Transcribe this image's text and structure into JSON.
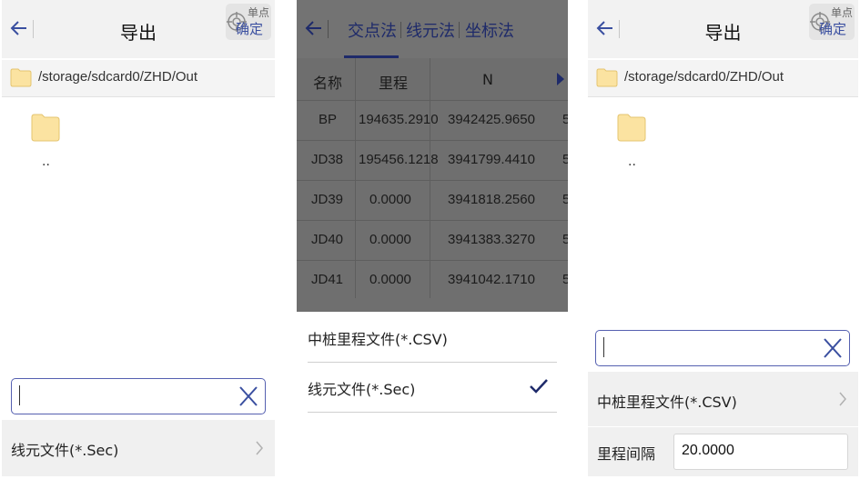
{
  "panel1": {
    "title": "导出",
    "confirm_label": "确定",
    "confirm_badge": "单点",
    "path": "/storage/sdcard0/ZHD/Out",
    "parent_dir": "..",
    "input_value": "",
    "format_row": "线元文件(*.Sec)"
  },
  "panel2": {
    "tabs": [
      "交点法",
      "线元法",
      "坐标法"
    ],
    "active_tab": "交点法",
    "columns": [
      "名称",
      "里程",
      "N"
    ],
    "rows": [
      {
        "name": "BP",
        "mileage": "194635.2910",
        "n": "3942425.9650",
        "e": "5"
      },
      {
        "name": "JD38",
        "mileage": "195456.1218",
        "n": "3941799.4410",
        "e": "5"
      },
      {
        "name": "JD39",
        "mileage": "0.0000",
        "n": "3941818.2560",
        "e": "5"
      },
      {
        "name": "JD40",
        "mileage": "0.0000",
        "n": "3941383.3270",
        "e": "5"
      },
      {
        "name": "JD41",
        "mileage": "0.0000",
        "n": "3941042.1710",
        "e": "5"
      }
    ],
    "options": [
      {
        "label": "中桩里程文件(*.CSV)",
        "selected": false
      },
      {
        "label": "线元文件(*.Sec)",
        "selected": true
      }
    ],
    "accent": "#1e2a6a"
  },
  "panel3": {
    "title": "导出",
    "confirm_label": "确定",
    "confirm_badge": "单点",
    "path": "/storage/sdcard0/ZHD/Out",
    "parent_dir": "..",
    "input_value": "",
    "format_row": "中桩里程文件(*.CSV)",
    "mileage_label": "里程间隔",
    "mileage_value": "20.0000"
  },
  "icons": {
    "back": "arrow-left-icon",
    "confirm": "crosshair-icon",
    "folder": "folder-icon",
    "clear": "close-icon",
    "chevron": "chevron-right-icon",
    "check": "checkmark-icon",
    "more": "triangle-right-icon"
  },
  "colors": {
    "accent": "#3a4fa0",
    "folder": "#fbe3a1",
    "folder_border": "#e4c470"
  }
}
